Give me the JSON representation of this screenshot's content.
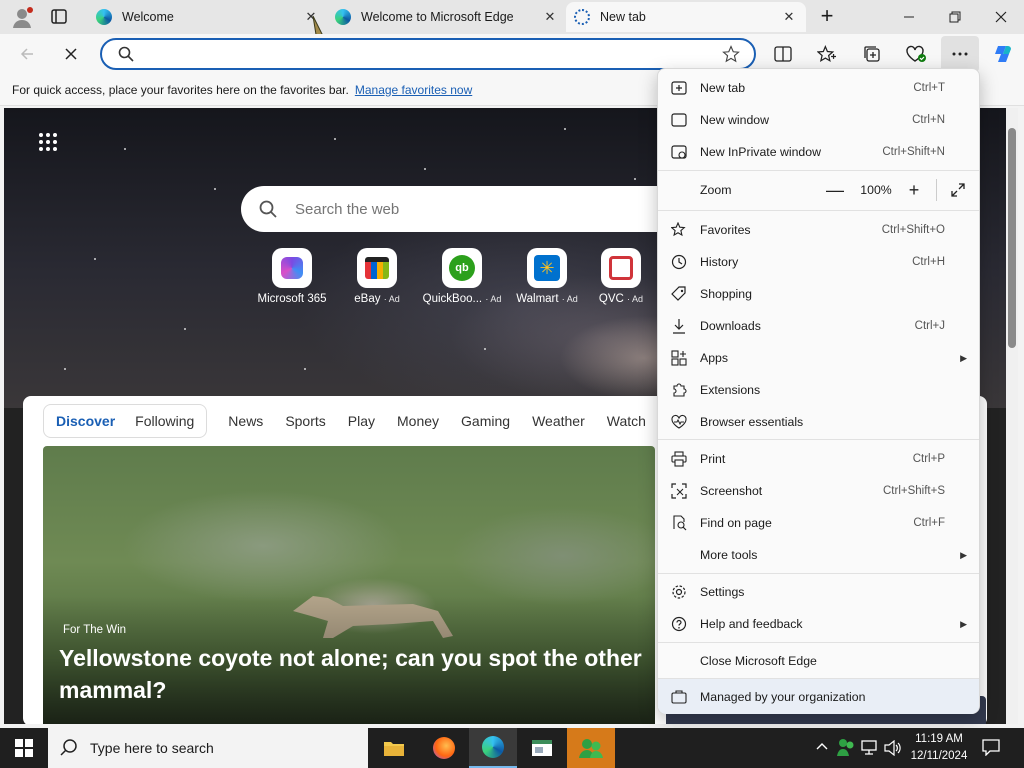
{
  "tabs": [
    {
      "title": "Welcome",
      "close": "✕"
    },
    {
      "title": "Welcome to Microsoft Edge",
      "close": "✕"
    },
    {
      "title": "New tab",
      "close": "✕"
    }
  ],
  "new_tab_glyph": "+",
  "favorites_bar": {
    "text": "For quick access, place your favorites here on the favorites bar.",
    "link": "Manage favorites now"
  },
  "newtab_page": {
    "search_placeholder": "Search the web",
    "quick_links": [
      {
        "label": "Microsoft 365",
        "ad": ""
      },
      {
        "label": "eBay",
        "ad": "· Ad"
      },
      {
        "label": "QuickBoo...",
        "ad": "· Ad"
      },
      {
        "label": "Walmart",
        "ad": "· Ad"
      },
      {
        "label": "QVC",
        "ad": "· Ad"
      }
    ],
    "feed_tabs_primary": [
      "Discover",
      "Following"
    ],
    "feed_tabs": [
      "News",
      "Sports",
      "Play",
      "Money",
      "Gaming",
      "Weather",
      "Watch"
    ],
    "story": {
      "source": "For The Win",
      "headline": "Yellowstone coyote not alone; can you spot the other mammal?"
    }
  },
  "menu": {
    "items": [
      {
        "label": "New tab",
        "shortcut": "Ctrl+T"
      },
      {
        "label": "New window",
        "shortcut": "Ctrl+N"
      },
      {
        "label": "New InPrivate window",
        "shortcut": "Ctrl+Shift+N"
      }
    ],
    "zoom": {
      "label": "Zoom",
      "value": "100%",
      "minus": "—",
      "plus": "+"
    },
    "items2": [
      {
        "label": "Favorites",
        "shortcut": "Ctrl+Shift+O"
      },
      {
        "label": "History",
        "shortcut": "Ctrl+H"
      },
      {
        "label": "Shopping",
        "shortcut": ""
      },
      {
        "label": "Downloads",
        "shortcut": "Ctrl+J"
      },
      {
        "label": "Apps",
        "shortcut": ""
      },
      {
        "label": "Extensions",
        "shortcut": ""
      },
      {
        "label": "Browser essentials",
        "shortcut": ""
      }
    ],
    "items3": [
      {
        "label": "Print",
        "shortcut": "Ctrl+P"
      },
      {
        "label": "Screenshot",
        "shortcut": "Ctrl+Shift+S"
      },
      {
        "label": "Find on page",
        "shortcut": "Ctrl+F"
      },
      {
        "label": "More tools",
        "shortcut": ""
      }
    ],
    "items4": [
      {
        "label": "Settings",
        "shortcut": ""
      },
      {
        "label": "Help and feedback",
        "shortcut": ""
      }
    ],
    "close": "Close Microsoft Edge",
    "managed": "Managed by your organization"
  },
  "taskbar": {
    "search_placeholder": "Type here to search",
    "time": "11:19 AM",
    "date": "12/11/2024"
  },
  "colors": {
    "accent": "#1a5fb4",
    "taskbar": "#1f1f1f"
  }
}
